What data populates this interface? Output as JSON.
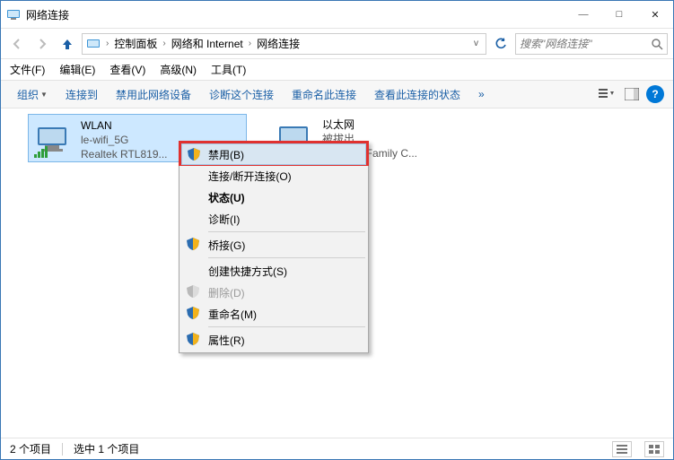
{
  "window": {
    "title": "网络连接"
  },
  "titlebar_buttons": {
    "min": "—",
    "max": "□",
    "close": "✕"
  },
  "breadcrumb": {
    "items": [
      "控制面板",
      "网络和 Internet",
      "网络连接"
    ],
    "dropdown_glyph": "v"
  },
  "search": {
    "placeholder": "搜索\"网络连接\""
  },
  "menubar": {
    "file": "文件(F)",
    "edit": "编辑(E)",
    "view": "查看(V)",
    "advanced": "高级(N)",
    "tools": "工具(T)"
  },
  "toolbar": {
    "organize": "组织",
    "connect_to": "连接到",
    "disable": "禁用此网络设备",
    "diagnose": "诊断这个连接",
    "rename": "重命名此连接",
    "status": "查看此连接的状态",
    "more": "»"
  },
  "adapters": {
    "wlan": {
      "name": "WLAN",
      "ssid": "le-wifi_5G",
      "device": "Realtek RTL819..."
    },
    "ethernet": {
      "name": "以太网",
      "status_line": "被拔出",
      "device": "PCIe FE Family C..."
    }
  },
  "context_menu": {
    "disable": "禁用(B)",
    "connect": "连接/断开连接(O)",
    "status": "状态(U)",
    "diagnose": "诊断(I)",
    "bridge": "桥接(G)",
    "shortcut": "创建快捷方式(S)",
    "delete": "删除(D)",
    "rename": "重命名(M)",
    "properties": "属性(R)"
  },
  "statusbar": {
    "count": "2 个项目",
    "selection": "选中 1 个项目"
  }
}
